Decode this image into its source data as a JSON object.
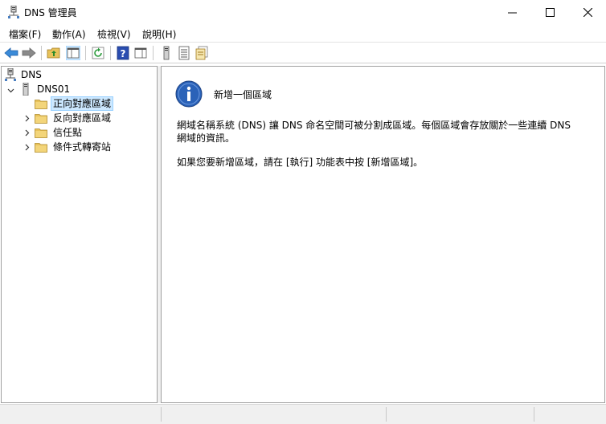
{
  "window": {
    "title": "DNS 管理員"
  },
  "menu": {
    "items": [
      {
        "label": "檔案(F)"
      },
      {
        "label": "動作(A)"
      },
      {
        "label": "檢視(V)"
      },
      {
        "label": "說明(H)"
      }
    ]
  },
  "tree": {
    "root": "DNS",
    "server": "DNS01",
    "items": [
      {
        "label": "正向對應區域",
        "selected": true
      },
      {
        "label": "反向對應區域"
      },
      {
        "label": "信任點"
      },
      {
        "label": "條件式轉寄站"
      }
    ]
  },
  "content": {
    "heading": "新增一個區域",
    "para1_line1": "網域名稱系統 (DNS) 讓 DNS 命名空間可被分割成區域。每個區域會存放關於一些連續 DNS",
    "para1_line2": "網域的資訊。",
    "para2": "如果您要新增區域，請在 [執行] 功能表中按 [新增區域]。"
  },
  "colors": {
    "selection_bg": "#cce8ff",
    "selection_border": "#99d1ff",
    "info_icon": "#2a62b8",
    "folder": "#e8c25a"
  }
}
